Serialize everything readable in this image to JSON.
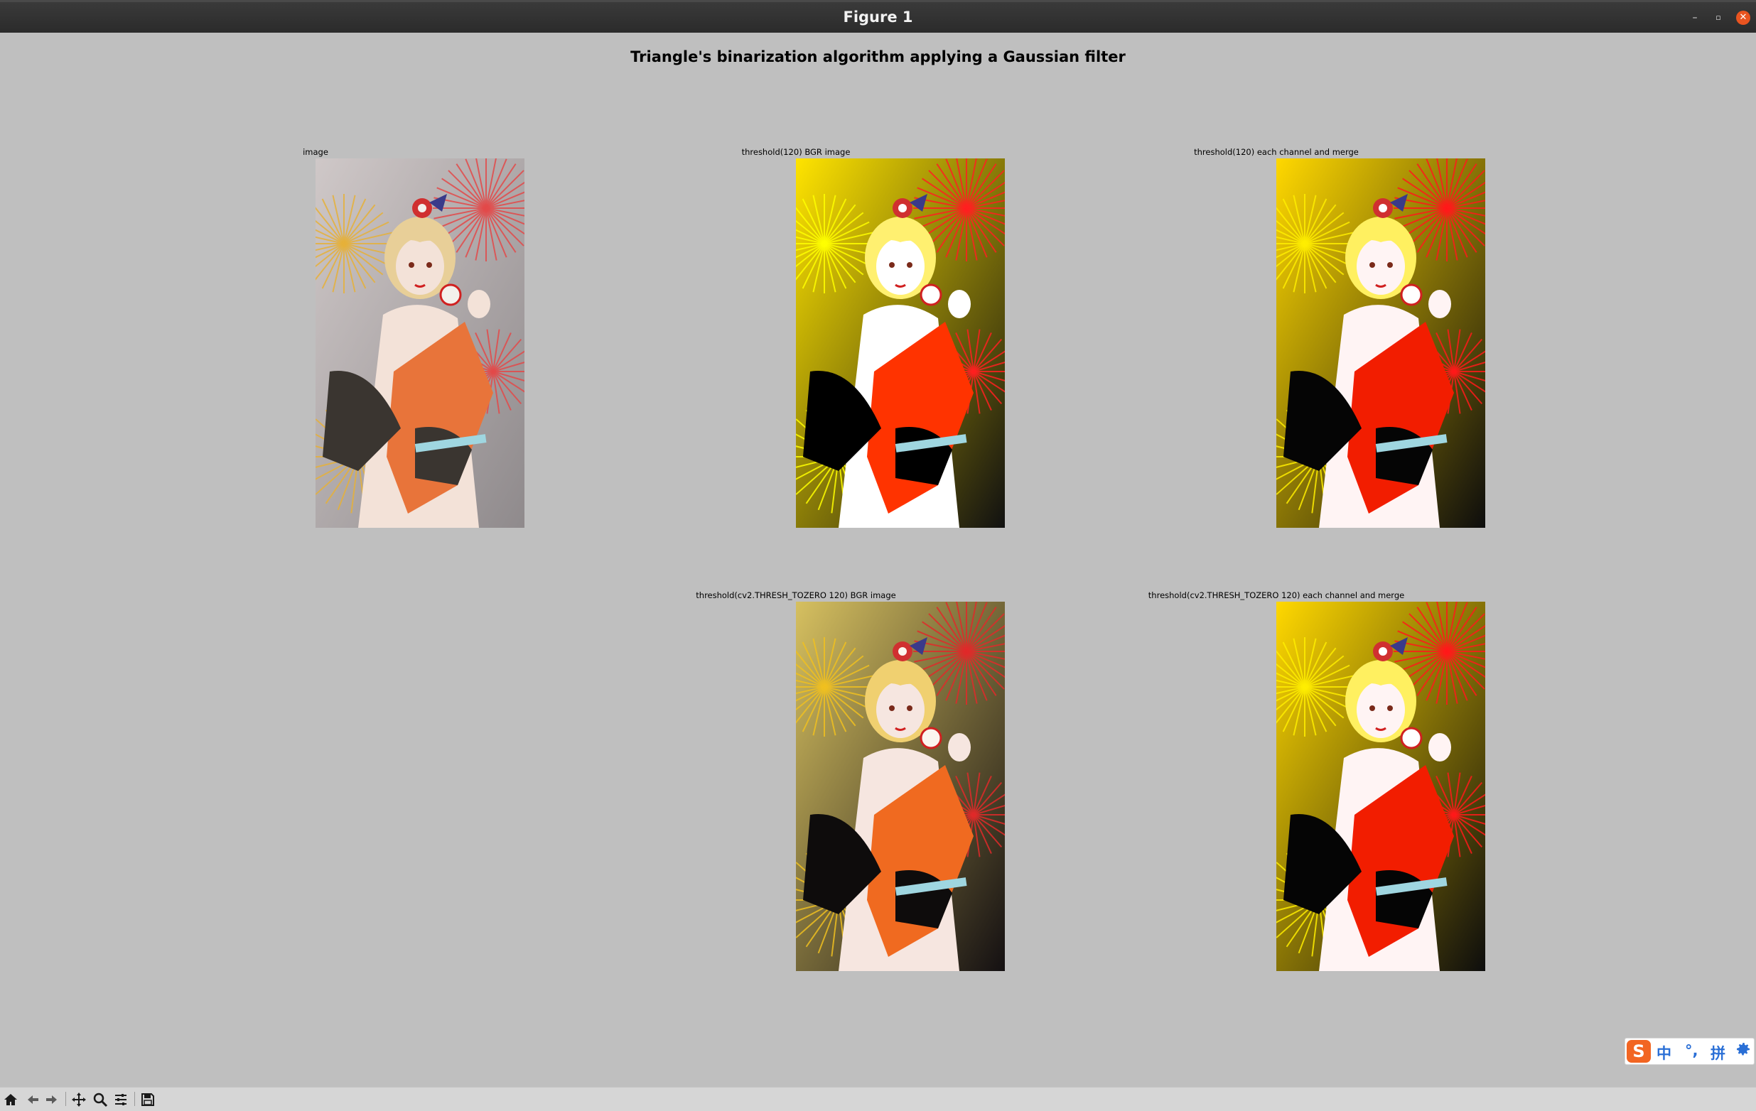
{
  "window": {
    "title": "Figure 1"
  },
  "figure": {
    "suptitle": "Triangle's binarization algorithm applying a Gaussian filter",
    "subplots": [
      {
        "id": "image",
        "caption": "image",
        "variant": "original"
      },
      {
        "id": "thresh-bgr",
        "caption": "threshold(120) BGR image",
        "variant": "binary"
      },
      {
        "id": "thresh-channel",
        "caption": "threshold(120) each channel and merge",
        "variant": "binary-merge"
      },
      {
        "id": "tozero-bgr",
        "caption": "threshold(cv2.THRESH_TOZERO 120) BGR image",
        "variant": "tozero"
      },
      {
        "id": "tozero-channel",
        "caption": "threshold(cv2.THRESH_TOZERO 120) each channel and merge",
        "variant": "binary-merge"
      }
    ]
  },
  "toolbar": {
    "items": [
      "home-icon",
      "back-icon",
      "forward-icon",
      "pan-icon",
      "zoom-icon",
      "configure-subplots-icon",
      "save-icon"
    ]
  },
  "ime": {
    "mode": "中",
    "punct": "°,",
    "layout": "拼",
    "settings": "gear-icon"
  },
  "colors": {
    "background": "#bfbfbf",
    "titlebar": "#2b2b2b",
    "close_button": "#e95420",
    "ime_accent": "#2a6fd6",
    "ime_logo": "#f26522"
  }
}
